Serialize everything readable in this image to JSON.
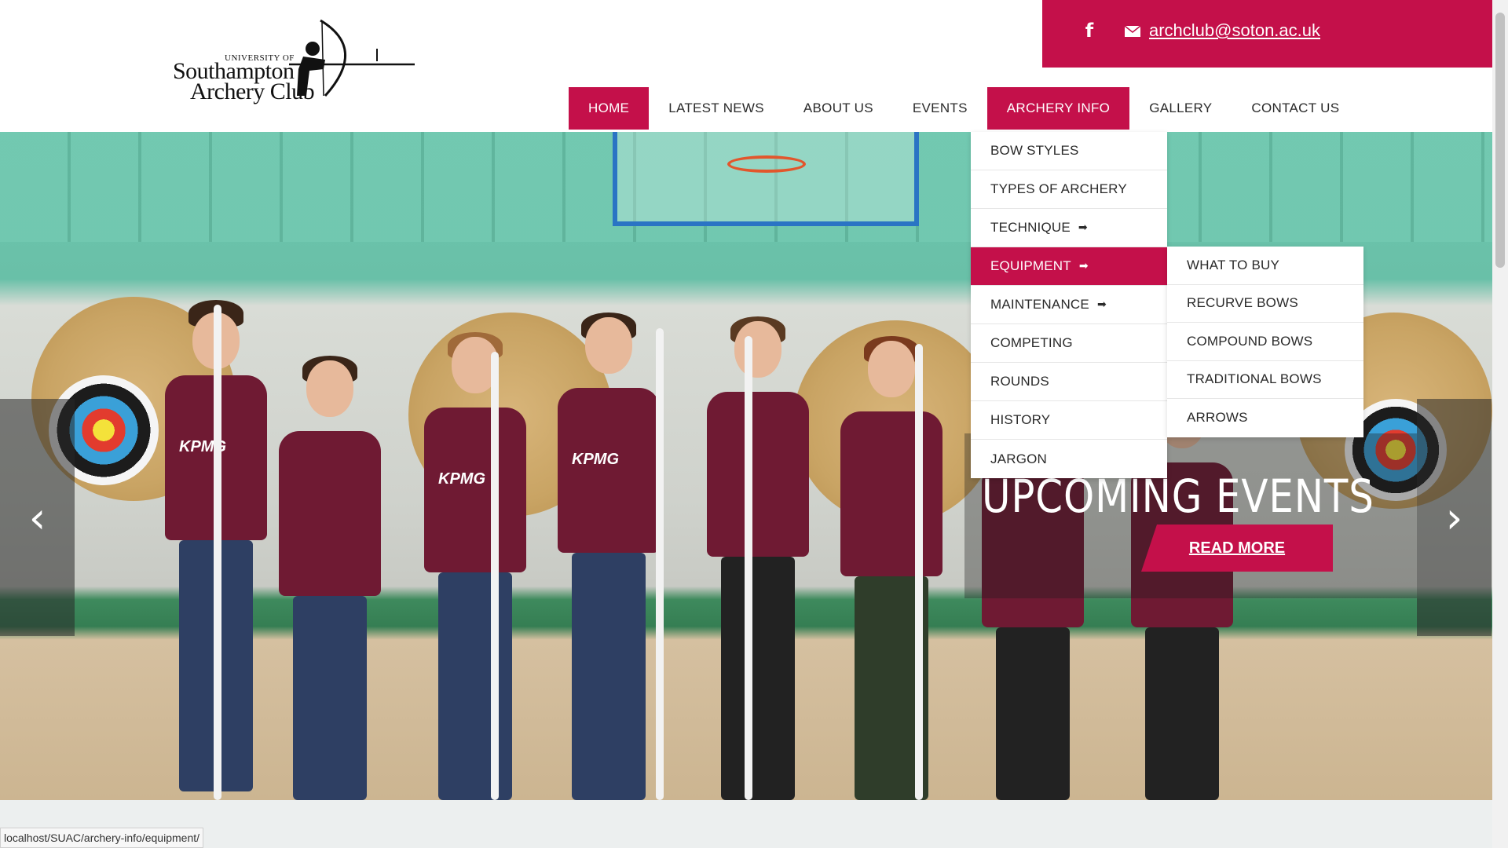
{
  "logo": {
    "line1": "UNIVERSITY OF",
    "line2": "Southampton",
    "line3": "Archery Club"
  },
  "topbar": {
    "facebook_icon": "facebook-icon",
    "mail_icon": "envelope-icon",
    "email": "archclub@soton.ac.uk",
    "accent": "#c4104a"
  },
  "nav": {
    "items": [
      {
        "label": "HOME"
      },
      {
        "label": "LATEST NEWS"
      },
      {
        "label": "ABOUT US"
      },
      {
        "label": "EVENTS"
      },
      {
        "label": "ARCHERY INFO"
      },
      {
        "label": "GALLERY"
      },
      {
        "label": "CONTACT US"
      }
    ]
  },
  "dropdown": {
    "items": [
      {
        "label": "BOW STYLES"
      },
      {
        "label": "TYPES OF ARCHERY"
      },
      {
        "label": "TECHNIQUE",
        "arrow": "➡"
      },
      {
        "label": "EQUIPMENT",
        "arrow": "➡"
      },
      {
        "label": "MAINTENANCE",
        "arrow": "➡"
      },
      {
        "label": "COMPETING"
      },
      {
        "label": "ROUNDS"
      },
      {
        "label": "HISTORY"
      },
      {
        "label": "JARGON"
      }
    ]
  },
  "submenu": {
    "items": [
      {
        "label": "WHAT TO BUY"
      },
      {
        "label": "RECURVE BOWS"
      },
      {
        "label": "COMPOUND BOWS"
      },
      {
        "label": "TRADITIONAL BOWS"
      },
      {
        "label": "ARROWS"
      }
    ]
  },
  "hero": {
    "caption": "UPCOMING EVENTS",
    "button": "READ MORE",
    "prev_icon": "‹",
    "next_icon": "›",
    "shirt_text": "KPMG"
  },
  "status_bar": {
    "url": "localhost/SUAC/archery-info/equipment/"
  }
}
